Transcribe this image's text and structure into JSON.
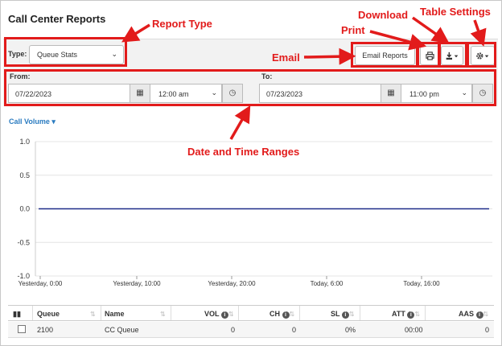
{
  "page": {
    "title": "Call Center Reports"
  },
  "type_filter": {
    "label": "Type:",
    "value": "Queue Stats"
  },
  "toolbar": {
    "email_label": "Email Reports",
    "print_icon": "print-icon",
    "download_icon": "download-icon",
    "settings_icon": "gear-icon"
  },
  "range": {
    "from_label": "From:",
    "from_date": "07/22/2023",
    "from_time": "12:00 am",
    "to_label": "To:",
    "to_date": "07/23/2023",
    "to_time": "11:00 pm"
  },
  "chart_menu": {
    "label": "Call Volume"
  },
  "annotations": {
    "report_type": "Report Type",
    "download": "Download",
    "table_settings": "Table Settings",
    "print": "Print",
    "email": "Email",
    "date_time": "Date and Time Ranges"
  },
  "chart_data": {
    "type": "line",
    "yticks": [
      "1.0",
      "0.5",
      "0.0",
      "-0.5",
      "-1.0"
    ],
    "ylim": [
      -1.0,
      1.0
    ],
    "xticks": [
      "Yesterday, 0:00",
      "Yesterday, 10:00",
      "Yesterday, 20:00",
      "Today, 6:00",
      "Today, 16:00"
    ],
    "series": [
      {
        "values": [
          0,
          0,
          0,
          0,
          0
        ]
      }
    ],
    "line_color": "#1f2d8a"
  },
  "table": {
    "columns": [
      "Queue",
      "Name",
      "VOL",
      "CH",
      "SL",
      "ATT",
      "AAS"
    ],
    "rows": [
      {
        "queue": "2100",
        "name": "CC Queue",
        "vol": "0",
        "ch": "0",
        "sl": "0%",
        "att": "00:00",
        "aas": "0"
      }
    ]
  }
}
